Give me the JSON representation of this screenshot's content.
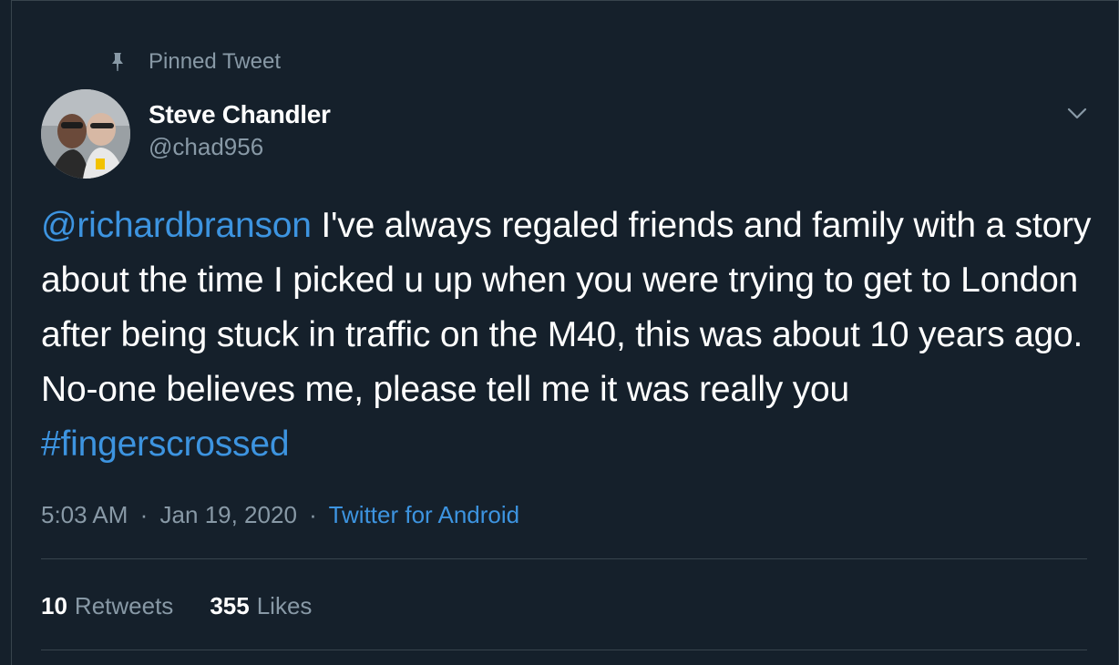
{
  "pinned": {
    "label": "Pinned Tweet",
    "icon": "pin-icon"
  },
  "author": {
    "name": "Steve Chandler",
    "handle": "@chad956",
    "avatar_icon": "avatar"
  },
  "tweet": {
    "mention": "@richardbranson",
    "body": " I've always regaled friends and family with a story about the time I picked u up when you were trying to get to London after being stuck in traffic on the M40, this was about 10 years ago. No-one believes me, please tell me it was really you ",
    "hashtag": "#fingerscrossed"
  },
  "meta": {
    "time": "5:03 AM",
    "separator1": "·",
    "date": "Jan 19, 2020",
    "separator2": "·",
    "source": "Twitter for Android"
  },
  "stats": {
    "retweets_count": "10",
    "retweets_label": "Retweets",
    "likes_count": "355",
    "likes_label": "Likes"
  },
  "colors": {
    "background": "#15202b",
    "link": "#3d94e0",
    "secondary_text": "#8899a6",
    "divider": "#38444d"
  },
  "menu_icon": "chevron-down-icon"
}
